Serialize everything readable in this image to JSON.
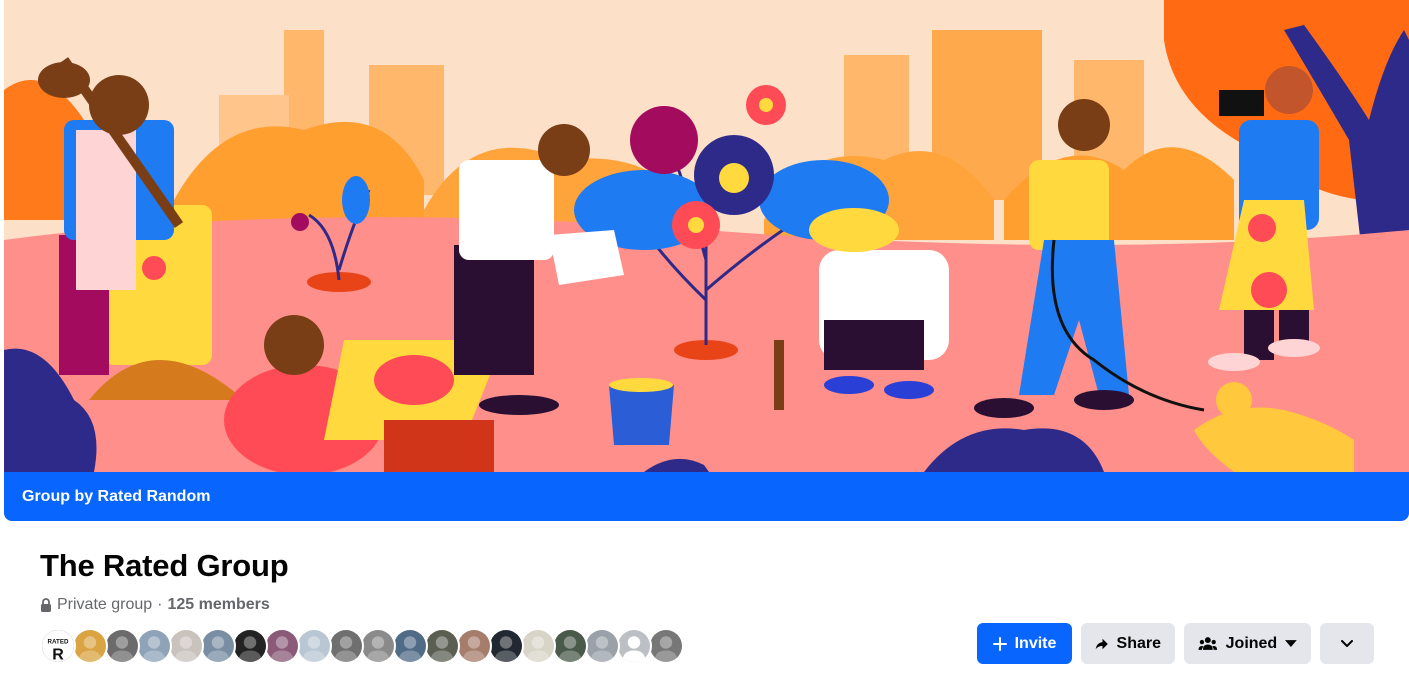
{
  "cover": {
    "banner_text": "Group by Rated Random"
  },
  "group": {
    "title": "The Rated Group",
    "privacy": "Private group",
    "separator": "·",
    "members": "125 members"
  },
  "member_avatars": [
    {
      "name": "avatar-rated-logo",
      "color": "#1c1e21",
      "label": "RATED"
    },
    {
      "name": "avatar-member",
      "color": "#d9a441"
    },
    {
      "name": "avatar-member",
      "color": "#6b6b6b"
    },
    {
      "name": "avatar-member",
      "color": "#8fa3b8"
    },
    {
      "name": "avatar-member",
      "color": "#c9c2bd"
    },
    {
      "name": "avatar-member",
      "color": "#7a8ea3"
    },
    {
      "name": "avatar-member",
      "color": "#232323"
    },
    {
      "name": "avatar-member",
      "color": "#8a5a78"
    },
    {
      "name": "avatar-member",
      "color": "#b9c6d3"
    },
    {
      "name": "avatar-member",
      "color": "#6f6f6f"
    },
    {
      "name": "avatar-member",
      "color": "#8a8a8a"
    },
    {
      "name": "avatar-member",
      "color": "#4f6b86"
    },
    {
      "name": "avatar-member",
      "color": "#5a5f52"
    },
    {
      "name": "avatar-member",
      "color": "#a67c6a"
    },
    {
      "name": "avatar-member",
      "color": "#222831"
    },
    {
      "name": "avatar-member",
      "color": "#d8d4c8"
    },
    {
      "name": "avatar-member",
      "color": "#4a5a4a"
    },
    {
      "name": "avatar-member",
      "color": "#9aa1a8"
    },
    {
      "name": "avatar-member-default",
      "color": "#bcc0c4"
    },
    {
      "name": "avatar-member",
      "color": "#777777"
    }
  ],
  "actions": {
    "invite_label": "Invite",
    "share_label": "Share",
    "joined_label": "Joined"
  },
  "colors": {
    "primary": "#0866ff",
    "secondary_bg": "#e4e6eb",
    "text_muted": "#65676b"
  }
}
